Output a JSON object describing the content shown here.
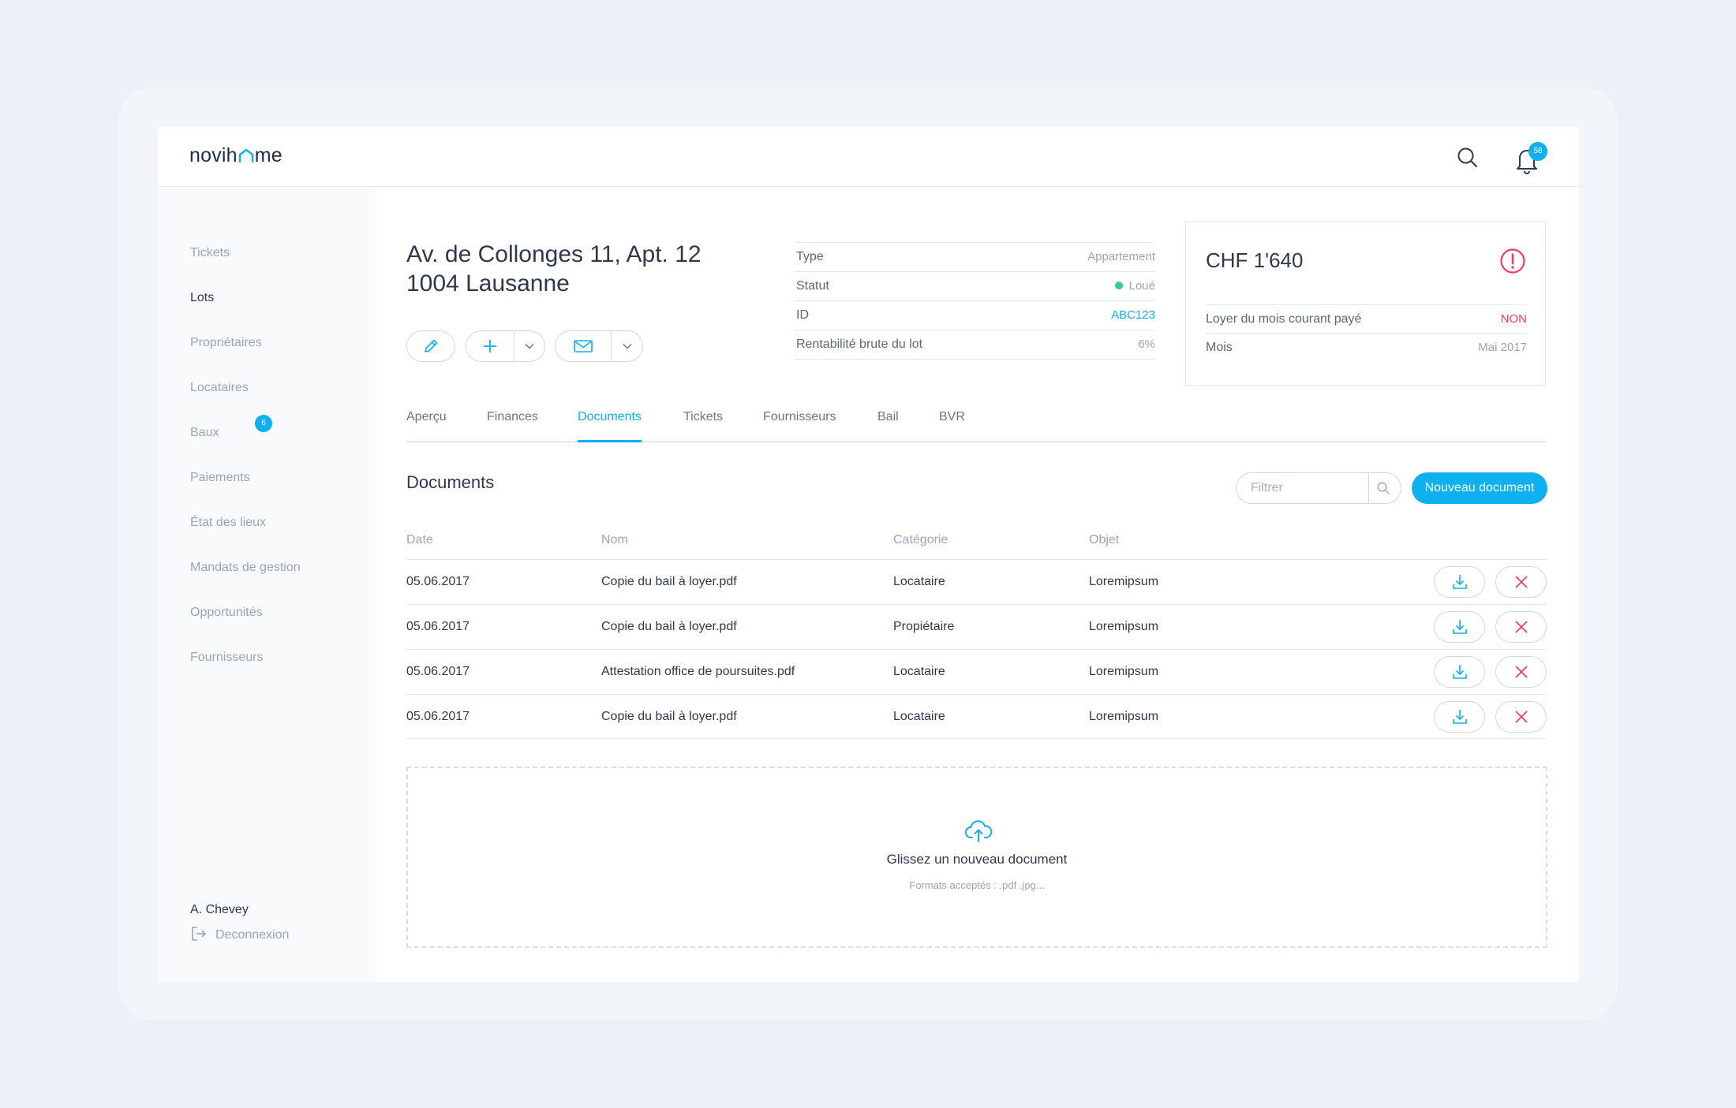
{
  "app": {
    "logo_text": "novihome",
    "logo_prefix": "novih",
    "logo_suffix": "me",
    "notifications_count": "58"
  },
  "sidebar": {
    "items": [
      {
        "label": "Tickets",
        "active": false
      },
      {
        "label": "Lots",
        "active": true
      },
      {
        "label": "Propriétaires",
        "active": false
      },
      {
        "label": "Locataires",
        "active": false
      },
      {
        "label": "Baux",
        "active": false,
        "badge": "6"
      },
      {
        "label": "Paiements",
        "active": false
      },
      {
        "label": "État des lieux",
        "active": false
      },
      {
        "label": "Mandats de gestion",
        "active": false
      },
      {
        "label": "Opportunités",
        "active": false
      },
      {
        "label": "Fournisseurs",
        "active": false
      }
    ],
    "user_name": "A. Chevey",
    "logout_label": "Deconnexion"
  },
  "property": {
    "address_line1": "Av. de Collonges 11, Apt. 12",
    "address_line2": "1004 Lausanne"
  },
  "details": [
    {
      "key": "Type",
      "value": "Appartement"
    },
    {
      "key": "Statut",
      "value": "Loué"
    },
    {
      "key": "ID",
      "value": "ABC123"
    },
    {
      "key": "Rentabilité brute du lot",
      "value": "6%"
    }
  ],
  "rent_card": {
    "amount": "CHF 1'640",
    "rows": [
      {
        "key": "Loyer du mois courant payé",
        "value": "NON"
      },
      {
        "key": "Mois",
        "value": "Mai 2017"
      }
    ]
  },
  "tabs": [
    {
      "label": "Aperçu",
      "active": false
    },
    {
      "label": "Finances",
      "active": false
    },
    {
      "label": "Documents",
      "active": true
    },
    {
      "label": "Tickets",
      "active": false
    },
    {
      "label": "Fournisseurs",
      "active": false
    },
    {
      "label": "Bail",
      "active": false
    },
    {
      "label": "BVR",
      "active": false
    }
  ],
  "documents": {
    "title": "Documents",
    "filter_placeholder": "Filtrer",
    "new_button": "Nouveau document",
    "columns": [
      "Date",
      "Nom",
      "Catégorie",
      "Objet"
    ],
    "rows": [
      {
        "date": "05.06.2017",
        "name": "Copie du bail à loyer.pdf",
        "category": "Locataire",
        "object": "Loremipsum"
      },
      {
        "date": "05.06.2017",
        "name": "Copie du bail à loyer.pdf",
        "category": "Propiétaire",
        "object": "Loremipsum"
      },
      {
        "date": "05.06.2017",
        "name": "Attestation office de poursuites.pdf",
        "category": "Locataire",
        "object": "Loremipsum"
      },
      {
        "date": "05.06.2017",
        "name": "Copie du bail à loyer.pdf",
        "category": "Locataire",
        "object": "Loremipsum"
      }
    ]
  },
  "dropzone": {
    "title": "Glissez un nouveau document",
    "subtitle": "Formats acceptés : .pdf .jpg..."
  },
  "colors": {
    "accent": "#0eb0f2",
    "danger": "#f03e5a",
    "success": "#2ecc9a",
    "text": "#2e3a4b",
    "muted": "#9aa6b5"
  }
}
